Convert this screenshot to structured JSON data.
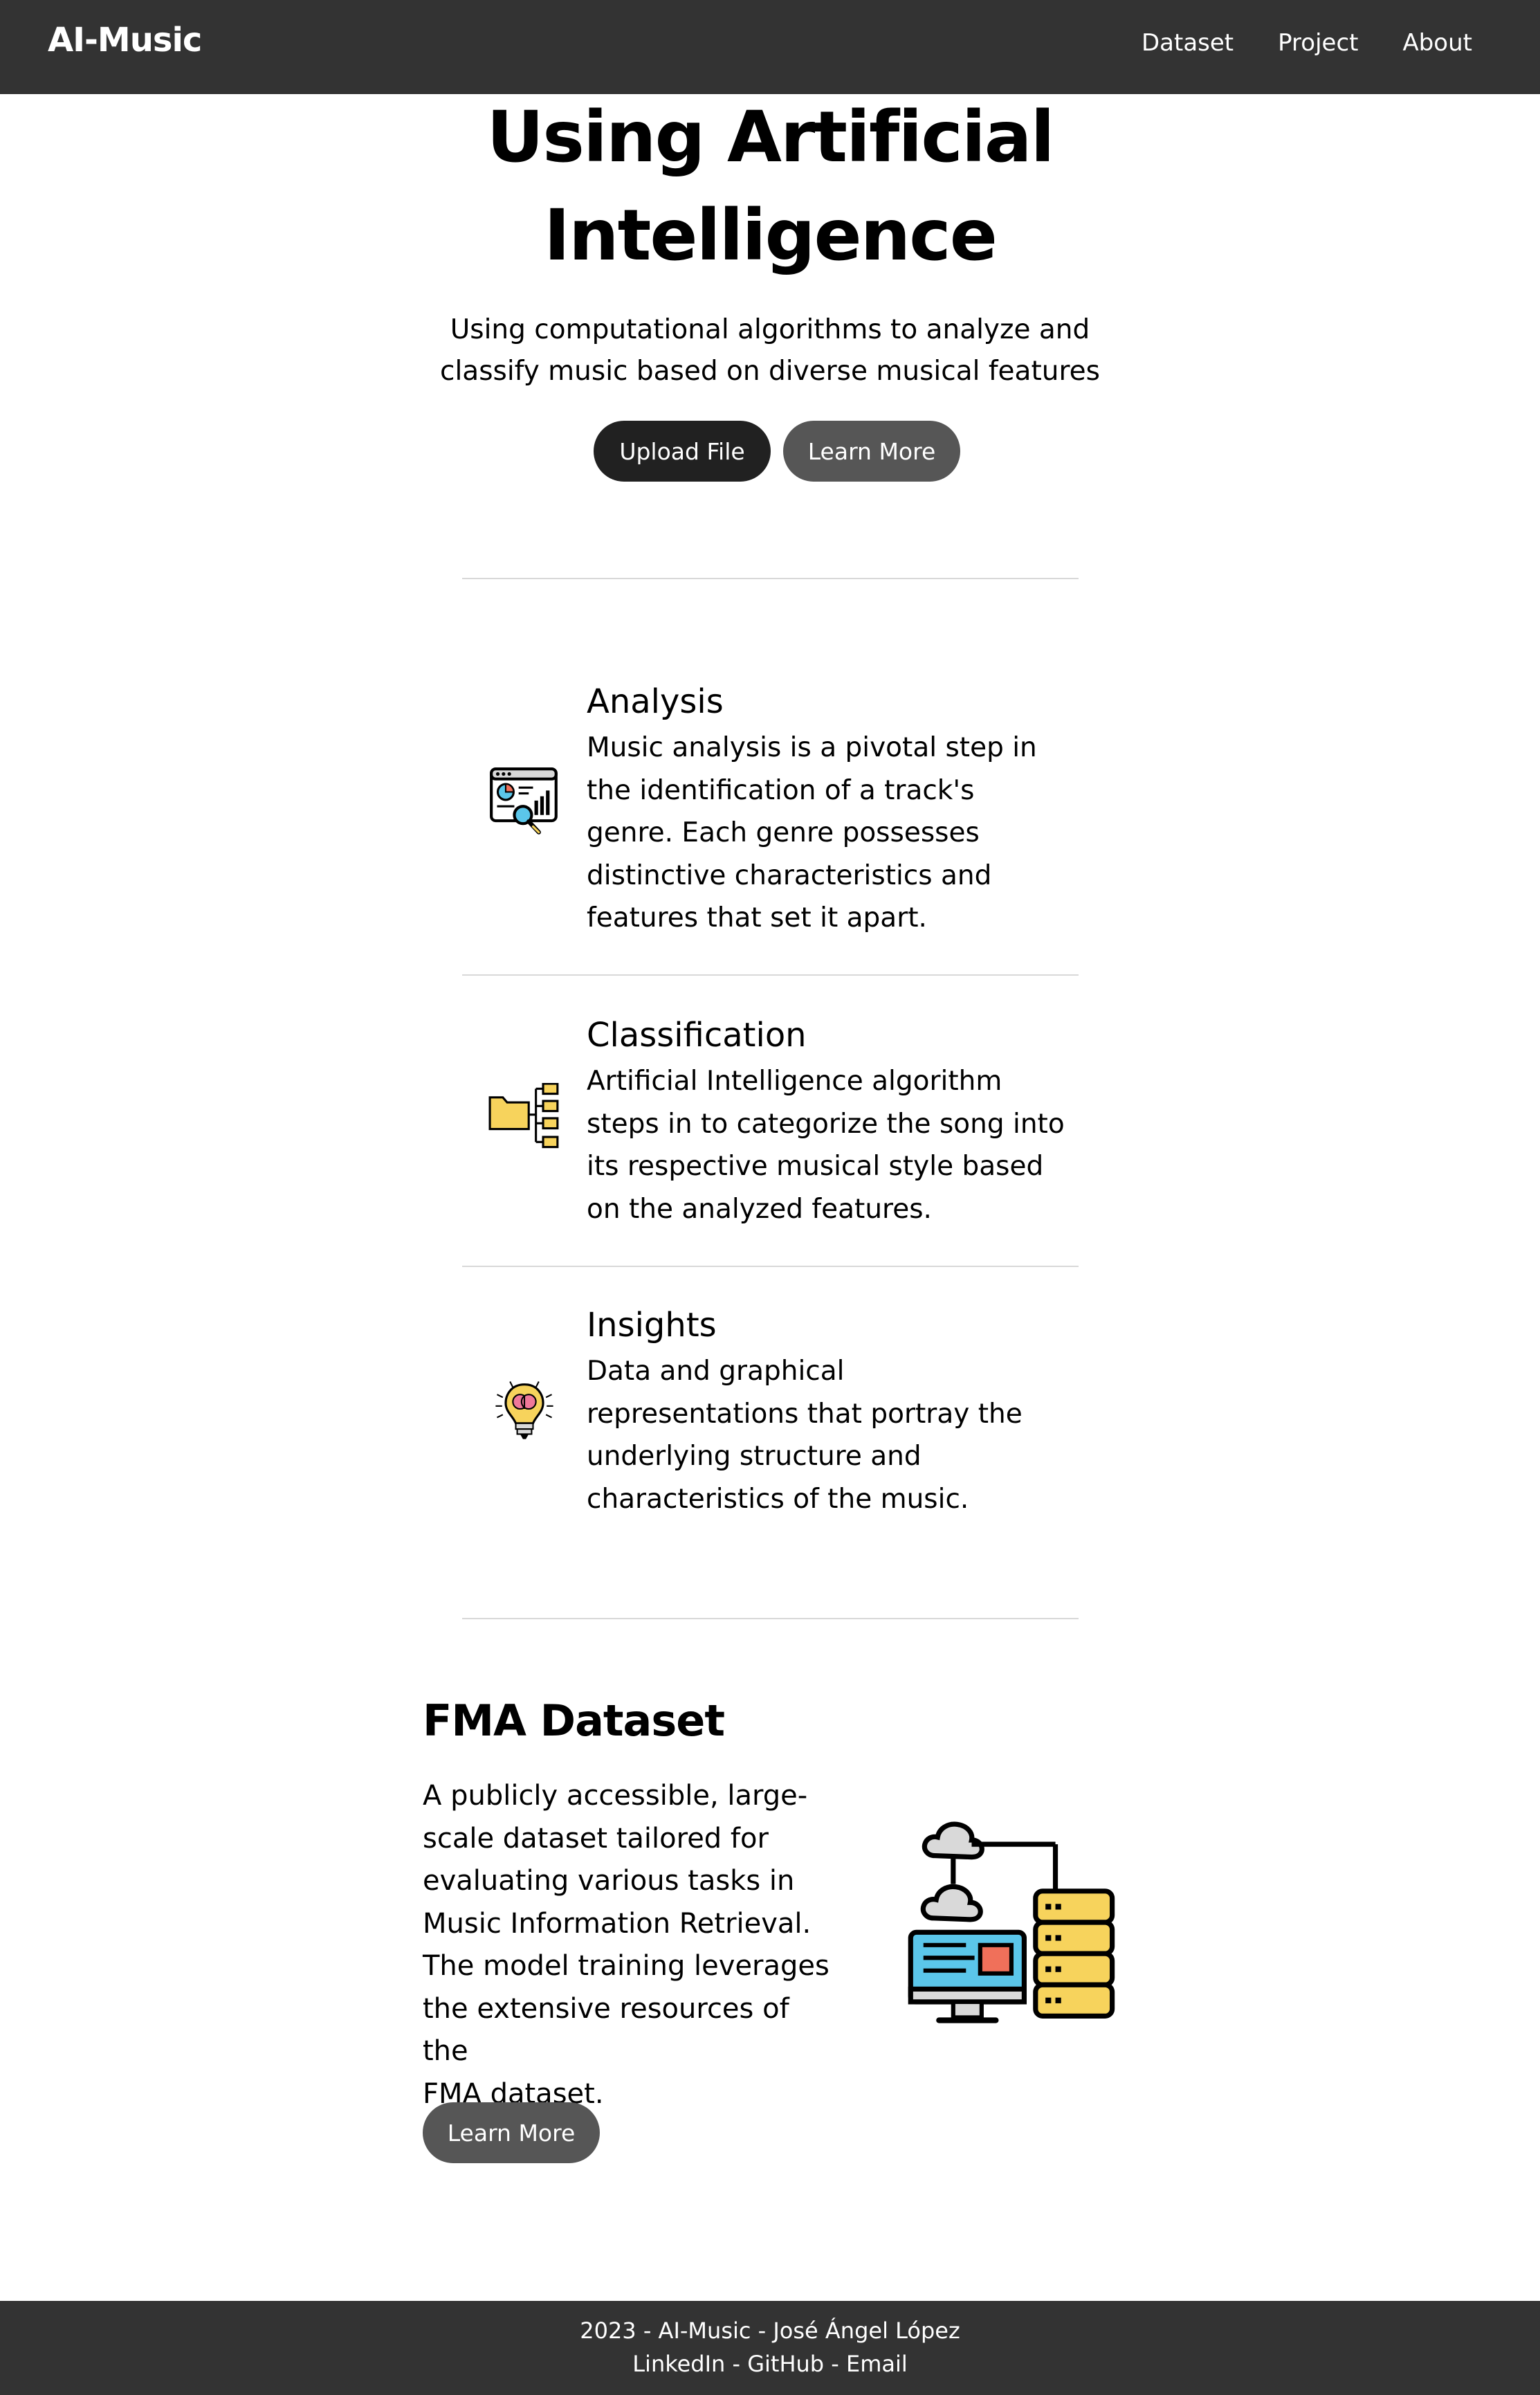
{
  "nav": {
    "brand": "AI-Music",
    "links": [
      "Dataset",
      "Project",
      "About"
    ]
  },
  "hero": {
    "title_line1": "Using Artificial",
    "title_line2": "Intelligence",
    "subtitle_line1": "Using computational algorithms to analyze and",
    "subtitle_line2": "classify music based on diverse musical features",
    "upload_label": "Upload File",
    "learn_more_label": "Learn More"
  },
  "features": [
    {
      "title": "Analysis",
      "icon": "analytics-icon",
      "lines": [
        "Music analysis is a pivotal step in",
        "the identification of a track's",
        "genre. Each genre possesses",
        "distinctive characteristics and",
        "features that set it apart."
      ]
    },
    {
      "title": "Classification",
      "icon": "folder-hierarchy-icon",
      "lines": [
        "Artificial Intelligence algorithm",
        "steps in to categorize the song into",
        "its respective musical style based",
        "on the analyzed features."
      ]
    },
    {
      "title": "Insights",
      "icon": "brain-lightbulb-icon",
      "lines": [
        "Data and graphical",
        "representations that portray the",
        "underlying structure and",
        "characteristics of the music."
      ]
    }
  ],
  "fma": {
    "title": "FMA Dataset",
    "icon": "cloud-server-icon",
    "lines": [
      "A publicly accessible, large-",
      "scale dataset tailored for",
      "evaluating various tasks in",
      "Music Information Retrieval.",
      "The model training leverages",
      "the extensive resources of the",
      "FMA dataset."
    ],
    "learn_more_label": "Learn More"
  },
  "footer": {
    "line1": "2023 - AI-Music - José Ángel López",
    "linkedin": "LinkedIn",
    "github": "GitHub",
    "email": "Email",
    "sep": " - "
  },
  "colors": {
    "nav_bg": "#333333",
    "btn_dark": "#212121",
    "btn_grey": "#565656",
    "divider": "#d8d8d8",
    "icon_yellow": "#f7d35c",
    "icon_blue": "#5bc6ea",
    "icon_red": "#f0705a",
    "icon_grey": "#d9d9d9"
  }
}
